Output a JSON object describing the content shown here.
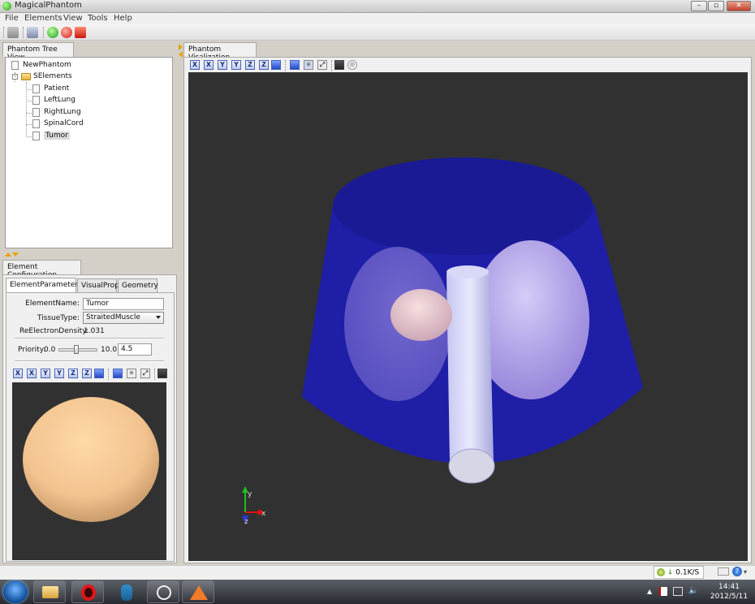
{
  "window": {
    "title": "MagicalPhantom"
  },
  "menu": [
    "File",
    "Elements",
    "View",
    "Tools",
    "Help"
  ],
  "tree_panel": {
    "header": "Phantom Tree View",
    "root": "NewPhantom",
    "folder": "SElements",
    "children": [
      "Patient",
      "LeftLung",
      "RightLung",
      "SpinalCord",
      "Tumor"
    ]
  },
  "config_panel": {
    "header": "Element Configuration",
    "tabs": [
      "ElementParameters",
      "VisualProp",
      "Geometry"
    ],
    "element_name_label": "ElementName:",
    "element_name_value": "Tumor",
    "tissue_label": "TissueType:",
    "tissue_value": "StraitedMuscle",
    "density_label": "ReElectronDensity:",
    "density_value": "1.031",
    "priority_label": "Priority:",
    "priority_min": "0.0",
    "priority_max": "10.0",
    "priority_value": "4.5",
    "priority_level_fraction": 0.45
  },
  "view_panel": {
    "header": "Phantom Visalization"
  },
  "view_buttons": [
    "X",
    "X",
    "Y",
    "Y",
    "Z",
    "Z"
  ],
  "axes": {
    "x": "x",
    "y": "y",
    "z": "z"
  },
  "colors": {
    "viewport_bg": "#313131",
    "patient": "#2323b4",
    "tumor": "#e8c7c7",
    "preview_sphere": "#f2c38f"
  },
  "tray": {
    "network": "0.1K/S",
    "time": "14:41",
    "date": "2012/5/11"
  }
}
